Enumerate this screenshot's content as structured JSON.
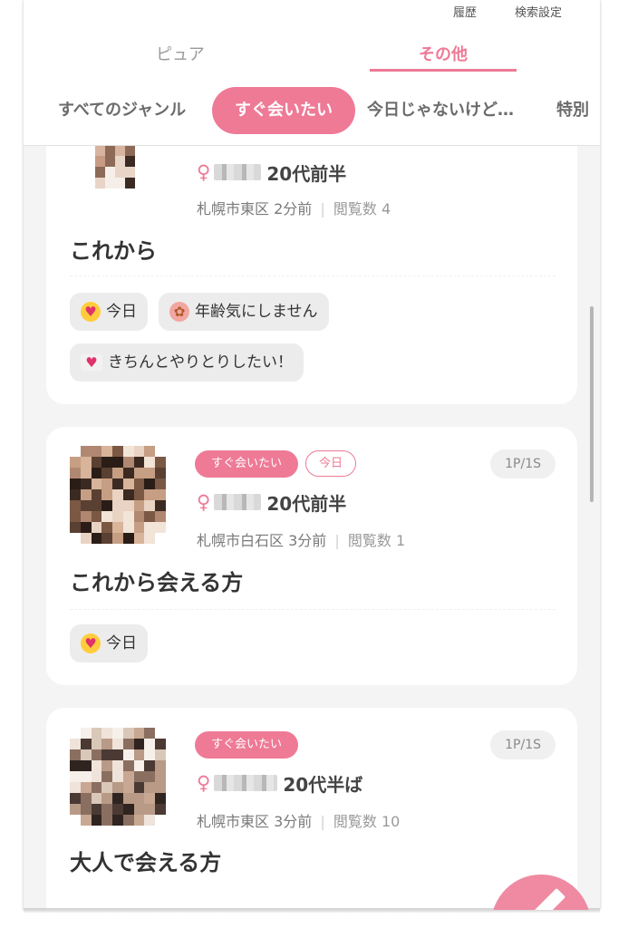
{
  "header": {
    "top_links": {
      "history": "履歴",
      "search_settings": "検索設定"
    },
    "main_tabs": [
      {
        "label": "ピュア",
        "active": false
      },
      {
        "label": "その他",
        "active": true
      }
    ],
    "genres": [
      {
        "label": "すべてのジャンル",
        "active": false
      },
      {
        "label": "すぐ会いたい",
        "active": true
      },
      {
        "label": "今日じゃないけど…",
        "active": false
      },
      {
        "label": "特別",
        "active": false
      }
    ]
  },
  "posts": [
    {
      "badges": [],
      "points": "",
      "gender_icon": "♀",
      "age": "20代前半",
      "area": "札幌市東区",
      "time": "2分前",
      "views": "閲覧数 4",
      "title": "これから",
      "chips": [
        {
          "emoji": "smiling-face-heart-eyes",
          "label": "今日"
        },
        {
          "emoji": "lion-face",
          "label": "年齢気にしません"
        },
        {
          "emoji": "love-letter",
          "label": "きちんとやりとりしたい！"
        }
      ]
    },
    {
      "badges": [
        "すぐ会いたい",
        "今日"
      ],
      "points": "1P/1S",
      "gender_icon": "♀",
      "age": "20代前半",
      "area": "札幌市白石区",
      "time": "3分前",
      "views": "閲覧数 1",
      "title": "これから会える方",
      "chips": [
        {
          "emoji": "smiling-face-heart-eyes",
          "label": "今日"
        }
      ]
    },
    {
      "badges": [
        "すぐ会いたい"
      ],
      "points": "1P/1S",
      "gender_icon": "♀",
      "age": "20代半ば",
      "area": "札幌市東区",
      "time": "3分前",
      "views": "閲覧数 10",
      "title": "大人で会える方",
      "chips": []
    }
  ],
  "colors": {
    "accent": "#ee7a96",
    "background": "#f4f4f4",
    "card": "#ffffff",
    "chip": "#ececec"
  },
  "fab": {
    "icon": "pencil-icon"
  }
}
